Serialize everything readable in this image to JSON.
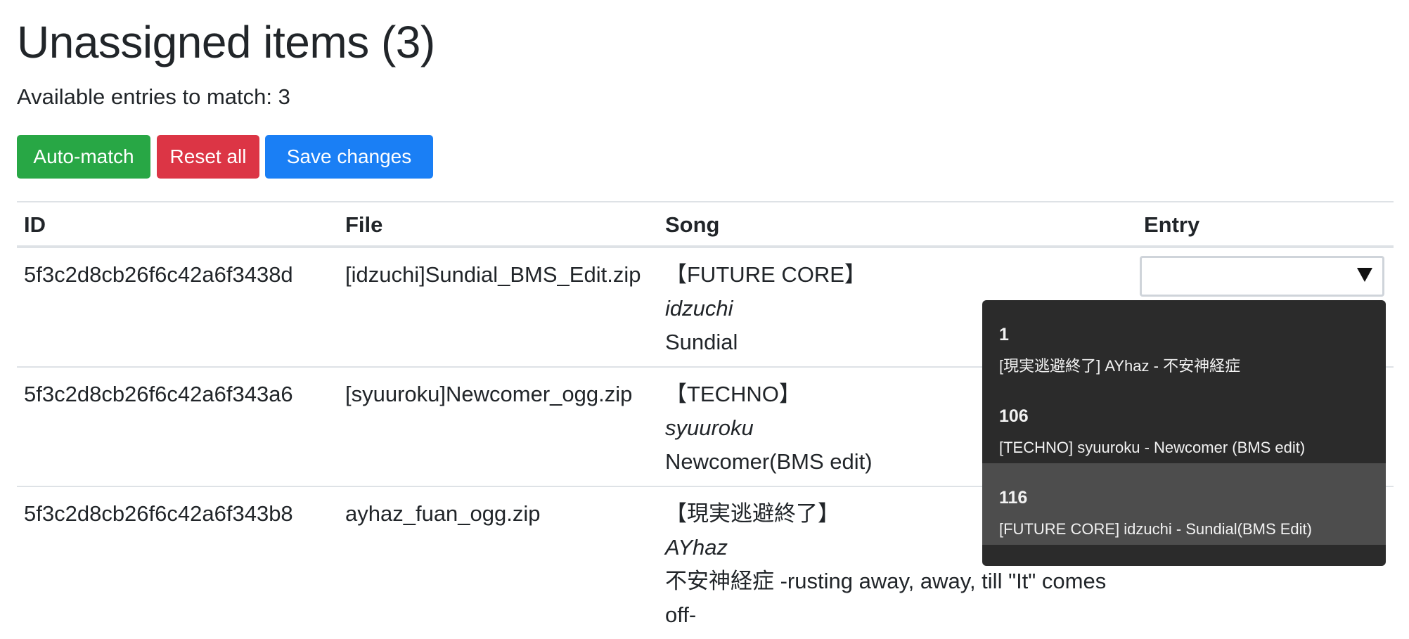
{
  "header": {
    "title": "Unassigned items (3)",
    "available_text": "Available entries to match: 3"
  },
  "toolbar": {
    "auto_match_label": "Auto-match",
    "reset_all_label": "Reset all",
    "save_changes_label": "Save changes"
  },
  "colors": {
    "auto_match": "#28a745",
    "reset_all": "#dc3545",
    "save_changes": "#1a7ff5",
    "dropdown_bg": "#2b2b2b",
    "dropdown_highlight": "#4d4d4d"
  },
  "table": {
    "columns": [
      "ID",
      "File",
      "Song",
      "Entry"
    ],
    "rows": [
      {
        "id": "5f3c2d8cb26f6c42a6f3438d",
        "file": "[idzuchi]Sundial_BMS_Edit.zip",
        "genre": "【FUTURE CORE】",
        "artist": "idzuchi",
        "title": "Sundial"
      },
      {
        "id": "5f3c2d8cb26f6c42a6f343a6",
        "file": "[syuuroku]Newcomer_ogg.zip",
        "genre": "【TECHNO】",
        "artist": "syuuroku",
        "title": "Newcomer(BMS edit)"
      },
      {
        "id": "5f3c2d8cb26f6c42a6f343b8",
        "file": "ayhaz_fuan_ogg.zip",
        "genre": "【現実逃避終了】",
        "artist": "AYhaz",
        "title": "不安神経症 -rusting away, away, till \"It\" comes off-"
      }
    ]
  },
  "entry_select": {
    "value": "",
    "icon": "chevron-down-icon",
    "options": [
      {
        "number": "1",
        "label": "[現実逃避終了] AYhaz - 不安神経症"
      },
      {
        "number": "106",
        "label": "[TECHNO] syuuroku - Newcomer (BMS edit)"
      },
      {
        "number": "116",
        "label": "[FUTURE CORE] idzuchi - Sundial(BMS Edit)"
      }
    ]
  }
}
